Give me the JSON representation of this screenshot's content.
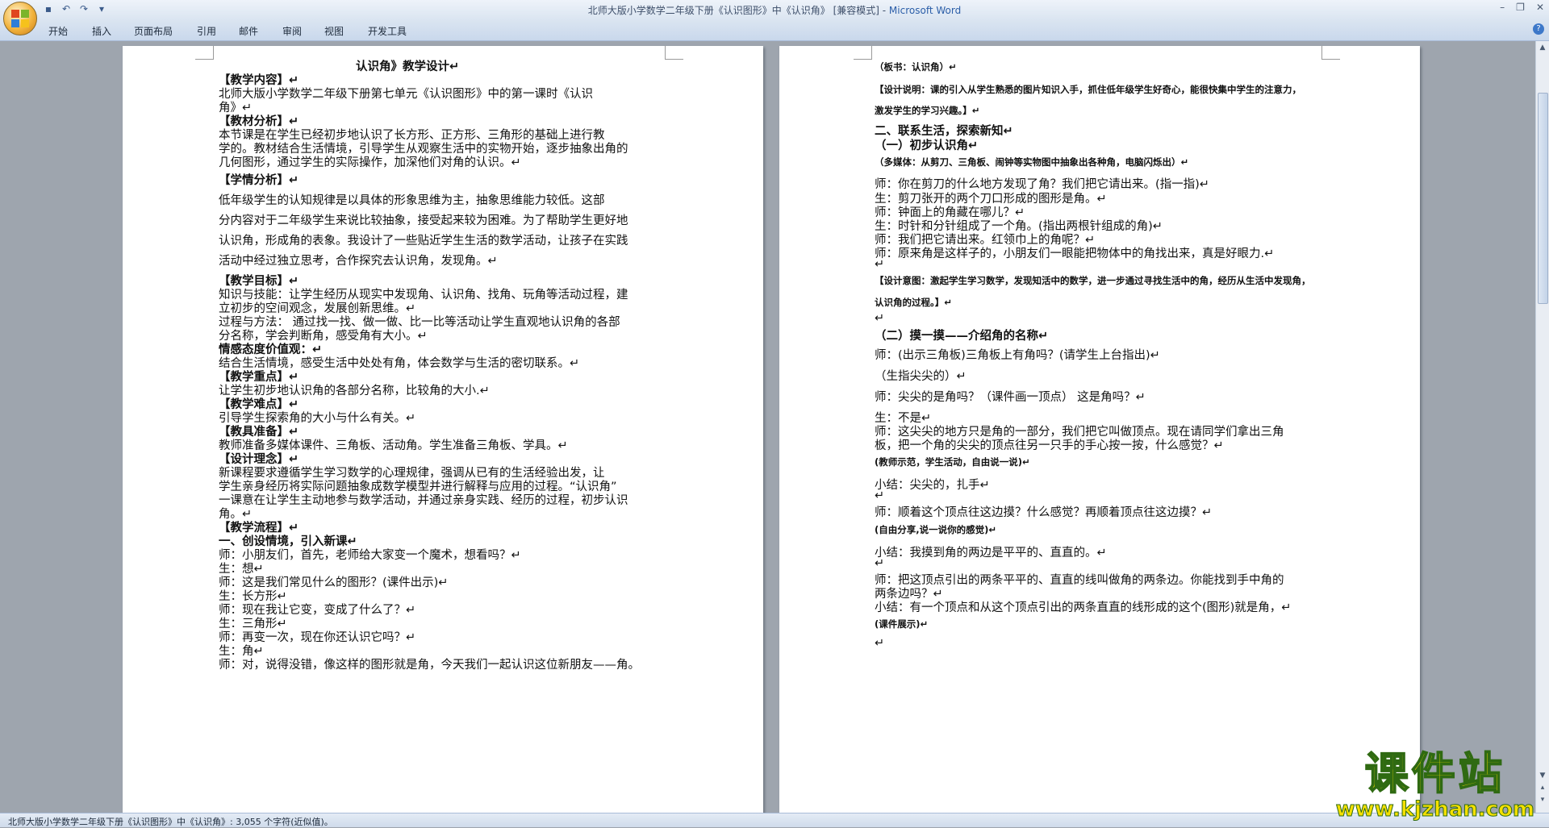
{
  "window": {
    "title": "北师大版小学数学二年级下册《认识图形》中《认识角》 [兼容模式] - ",
    "app_name": "Microsoft Word"
  },
  "ribbon": {
    "tabs": [
      "开始",
      "插入",
      "页面布局",
      "引用",
      "邮件",
      "审阅",
      "视图",
      "开发工具"
    ]
  },
  "status_bar": {
    "text": "北师大版小学数学二年级下册《认识图形》中《认识角》: 3,055 个字符(近似值)。"
  },
  "watermark": {
    "chinese": "课件站",
    "url": "www.kjzhan.com"
  },
  "left_page": [
    {
      "text": "认识角》教学设计↵",
      "cls": "b center"
    },
    {
      "text": "【教学内容】↵",
      "cls": "b"
    },
    {
      "text": "    北师大版小学数学二年级下册第七单元《认识图形》中的第一课时《认识",
      "cls": ""
    },
    {
      "text": "角》↵",
      "cls": ""
    },
    {
      "text": "【教材分析】↵",
      "cls": "b"
    },
    {
      "text": "    本节课是在学生已经初步地认识了长方形、正方形、三角形的基础上进行教",
      "cls": ""
    },
    {
      "text": "学的。教材结合生活情境，引导学生从观察生活中的实物开始，逐步抽象出角的",
      "cls": ""
    },
    {
      "text": "几何图形，通过学生的实际操作，加深他们对角的认识。↵",
      "cls": ""
    },
    {
      "text": "【学情分析】↵",
      "cls": "b"
    },
    {
      "text": "    低年级学生的认知规律是以具体的形象思维为主，抽象思维能力较低。这部",
      "cls": ""
    },
    {
      "text": "分内容对于二年级学生来说比较抽象，接受起来较为困难。为了帮助学生更好地",
      "cls": ""
    },
    {
      "text": "认识角，形成角的表象。我设计了一些贴近学生生活的数学活动，让孩子在实践",
      "cls": ""
    },
    {
      "text": "活动中经过独立思考，合作探究去认识角，发现角。↵",
      "cls": ""
    },
    {
      "text": "【教学目标】↵",
      "cls": "b"
    },
    {
      "text": "知识与技能：让学生经历从现实中发现角、认识角、找角、玩角等活动过程，建",
      "cls": "lead"
    },
    {
      "text": "            立初步的空间观念，发展创新思维。↵",
      "cls": ""
    },
    {
      "text": "过程与方法：  通过找一找、做一做、比一比等活动让学生直观地认识角的各部",
      "cls": "lead"
    },
    {
      "text": "            分名称，学会判断角，感受角有大小。↵",
      "cls": ""
    },
    {
      "text": "情感态度价值观：↵",
      "cls": "b"
    },
    {
      "text": "    结合生活情境，感受生活中处处有角，体会数学与生活的密切联系。↵",
      "cls": ""
    },
    {
      "text": "【教学重点】↵",
      "cls": "b"
    },
    {
      "text": "      让学生初步地认识角的各部分名称，比较角的大小.↵",
      "cls": ""
    },
    {
      "text": "【教学难点】↵",
      "cls": "b"
    },
    {
      "text": "      引导学生探索角的大小与什么有关。↵",
      "cls": ""
    },
    {
      "text": "【教具准备】↵",
      "cls": "b"
    },
    {
      "text": "      教师准备多媒体课件、三角板、活动角。学生准备三角板、学具。↵",
      "cls": ""
    },
    {
      "text": "【设计理念】↵",
      "cls": "b"
    },
    {
      "text": "    新课程要求遵循学生学习数学的心理规律，强调从已有的生活经验出发，让",
      "cls": ""
    },
    {
      "text": "学生亲身经历将实际问题抽象成数学模型并进行解释与应用的过程。“认识角”",
      "cls": ""
    },
    {
      "text": "一课意在让学生主动地参与数学活动，并通过亲身实践、经历的过程，初步认识",
      "cls": ""
    },
    {
      "text": "角。↵",
      "cls": ""
    },
    {
      "text": "【教学流程】↵",
      "cls": "b"
    },
    {
      "text": "一、创设情境，引入新课↵",
      "cls": "b"
    },
    {
      "text": "师：小朋友们，首先，老师给大家变一个魔术，想看吗？↵",
      "cls": ""
    },
    {
      "text": "生：想↵",
      "cls": ""
    },
    {
      "text": "师：这是我们常见什么的图形？(课件出示)↵",
      "cls": ""
    },
    {
      "text": "生：长方形↵",
      "cls": ""
    },
    {
      "text": "师：现在我让它变，变成了什么了？↵",
      "cls": ""
    },
    {
      "text": "生：三角形↵",
      "cls": ""
    },
    {
      "text": "师：再变一次，现在你还认识它吗？↵",
      "cls": ""
    },
    {
      "text": "生：角↵",
      "cls": ""
    },
    {
      "text": "师：对，说得没错，像这样的图形就是角，今天我们一起认识这位新朋友——角。",
      "cls": ""
    }
  ],
  "right_page": [
    {
      "text": "（板书：认识角）↵",
      "cls": "sm"
    },
    {
      "text": "【设计说明：课的引入从学生熟悉的图片知识入手，抓住低年级学生好奇心，能很快集中学生的注意力，",
      "cls": "sm"
    },
    {
      "text": "激发学生的学习兴趣。】↵",
      "cls": "sm"
    },
    {
      "text": "二、联系生活，探索新知↵",
      "cls": "b"
    },
    {
      "text": "（一）初步认识角↵",
      "cls": "b"
    },
    {
      "text": "（多媒体：从剪刀、三角板、闹钟等实物图中抽象出各种角，电脑闪烁出）↵",
      "cls": "sm"
    },
    {
      "text": "师：你在剪刀的什么地方发现了角？我们把它请出来。(指一指)↵",
      "cls": ""
    },
    {
      "text": "生：剪刀张开的两个刀口形成的图形是角。↵",
      "cls": ""
    },
    {
      "text": "师：钟面上的角藏在哪儿？↵",
      "cls": ""
    },
    {
      "text": "生：时针和分针组成了一个角。(指出两根针组成的角)↵",
      "cls": ""
    },
    {
      "text": "师：我们把它请出来。红领巾上的角呢？↵",
      "cls": ""
    },
    {
      "text": "师：原来角是这样子的，小朋友们一眼能把物体中的角找出来，真是好眼力.↵",
      "cls": ""
    },
    {
      "text": "↵",
      "cls": ""
    },
    {
      "text": "【设计意图：激起学生学习数学，发现知活中的数学，进一步通过寻找生活中的角，经历从生活中发现角，",
      "cls": "sm"
    },
    {
      "text": "认识角的过程。】↵",
      "cls": "sm"
    },
    {
      "text": "↵",
      "cls": ""
    },
    {
      "text": "（二）摸一摸——介绍角的名称↵",
      "cls": "b"
    },
    {
      "text": "师：(出示三角板)三角板上有角吗？(请学生上台指出)↵",
      "cls": ""
    },
    {
      "text": "    （生指尖尖的）↵",
      "cls": ""
    },
    {
      "text": "师：尖尖的是角吗？（课件画一顶点） 这是角吗？↵",
      "cls": ""
    },
    {
      "text": "生：不是↵",
      "cls": ""
    },
    {
      "text": "师：这尖尖的地方只是角的一部分，我们把它叫做顶点。现在请同学们拿出三角",
      "cls": ""
    },
    {
      "text": "    板，把一个角的尖尖的顶点往另一只手的手心按一按，什么感觉？↵",
      "cls": ""
    },
    {
      "text": "   (教师示范，学生活动，自由说一说)↵",
      "cls": "sm"
    },
    {
      "text": "小结：尖尖的，扎手↵",
      "cls": ""
    },
    {
      "text": "↵",
      "cls": ""
    },
    {
      "text": "师：顺着这个顶点往这边摸？什么感觉？再顺着顶点往这边摸？↵",
      "cls": ""
    },
    {
      "text": "   (自由分享,说一说你的感觉)↵",
      "cls": "sm"
    },
    {
      "text": "小结：我摸到角的两边是平平的、直直的。↵",
      "cls": ""
    },
    {
      "text": "↵",
      "cls": ""
    },
    {
      "text": "师：把这顶点引出的两条平平的、直直的线叫做角的两条边。你能找到手中角的",
      "cls": ""
    },
    {
      "text": "    两条边吗？↵",
      "cls": ""
    },
    {
      "text": "小结：有一个顶点和从这个顶点引出的两条直直的线形成的这个(图形)就是角，↵",
      "cls": ""
    },
    {
      "text": "   (课件展示)↵",
      "cls": "sm"
    },
    {
      "text": "↵",
      "cls": ""
    }
  ]
}
